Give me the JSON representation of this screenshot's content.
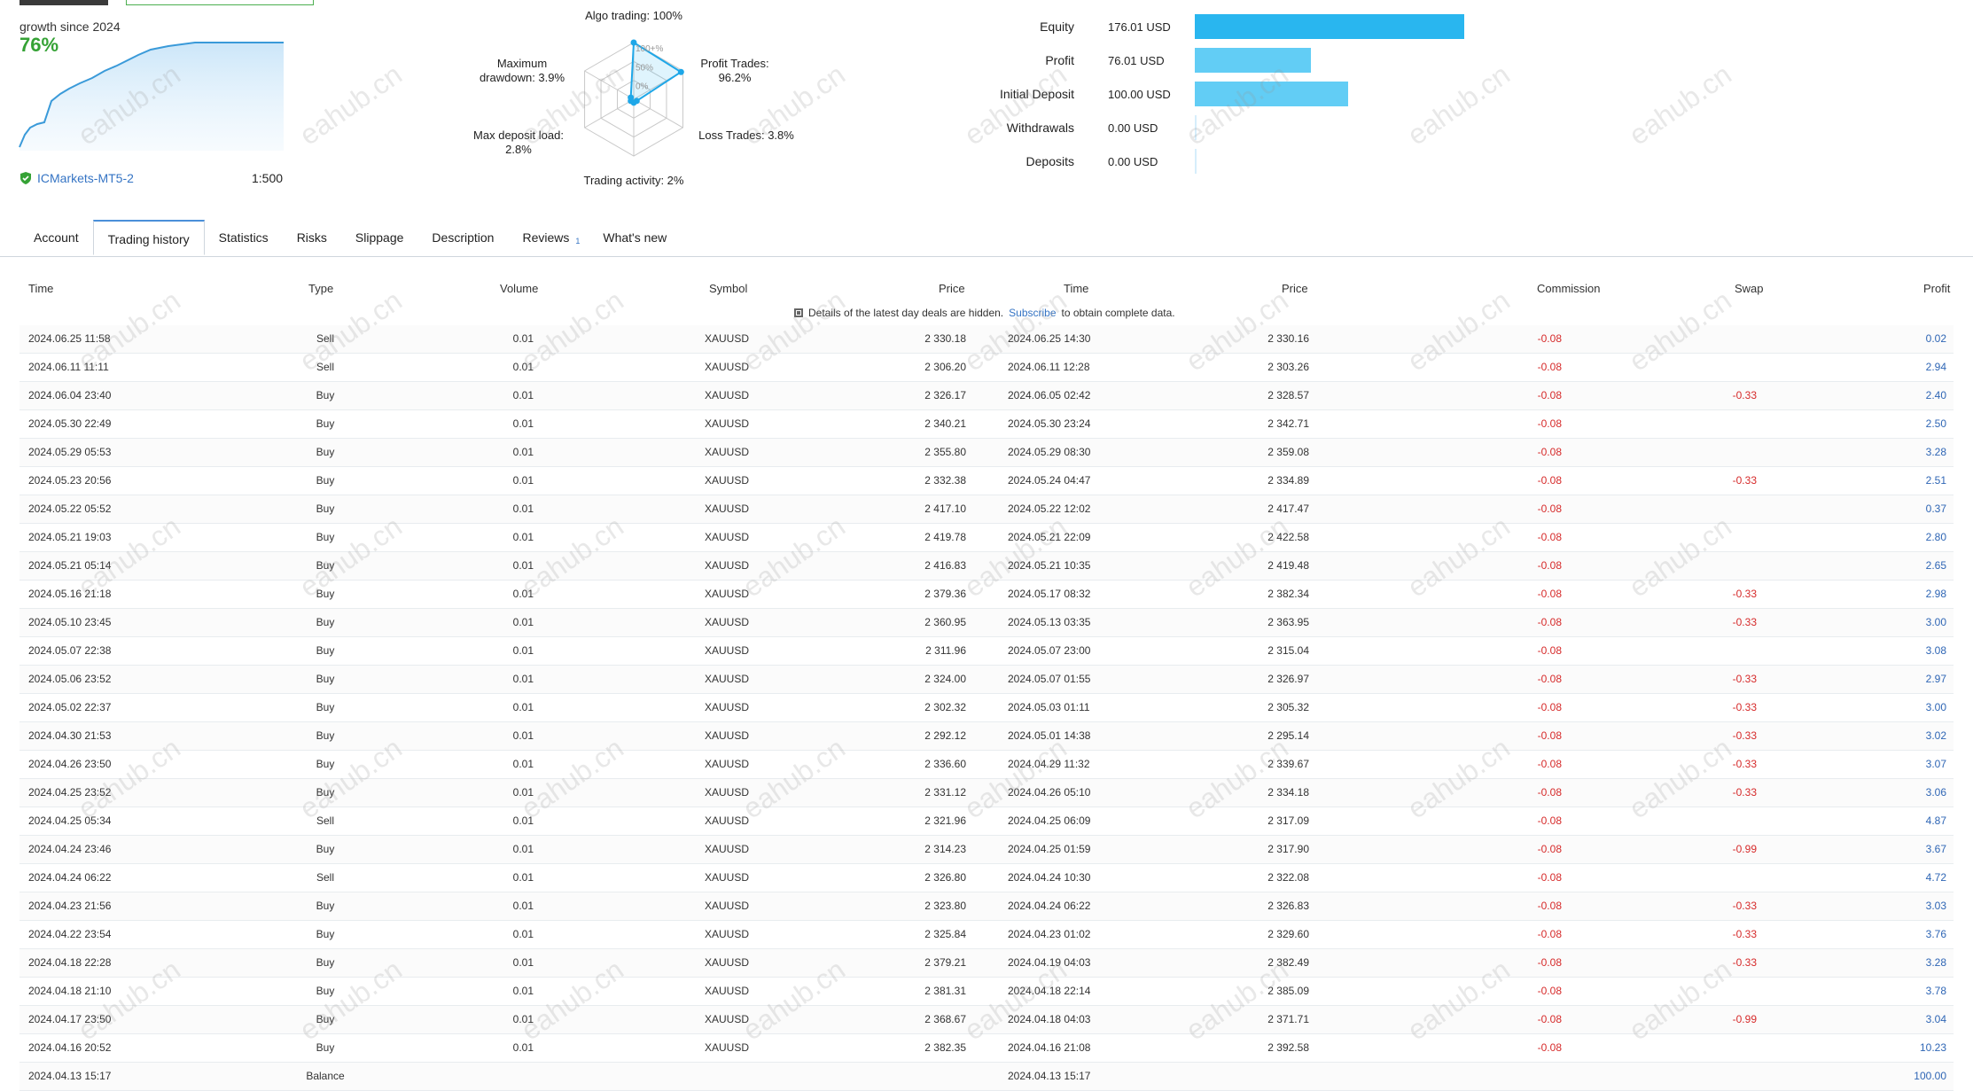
{
  "header": {
    "growth_label": "growth since 2024",
    "growth_value": "76%",
    "broker": "ICMarkets-MT5-2",
    "leverage": "1:500"
  },
  "radar": {
    "algo": "Algo trading: 100%",
    "profit": "Profit Trades:\n96.2%",
    "loss": "Loss Trades: 3.8%",
    "activity": "Trading activity: 2%",
    "deposit_load": "Max deposit load:\n2.8%",
    "drawdown": "Maximum\ndrawdown: 3.9%",
    "ring_100": "100+%",
    "ring_50": "50%",
    "ring_0": "0%",
    "algo_value": 1.0,
    "profit_value": 0.962,
    "loss_value": 0.038,
    "activity_value": 0.02,
    "deposit_load_value": 0.028,
    "drawdown_value": 0.039
  },
  "finance": [
    {
      "label": "Equity",
      "value": "176.01 USD",
      "fraction": 1.0,
      "color": "#29b6ef"
    },
    {
      "label": "Profit",
      "value": "76.01 USD",
      "fraction": 0.43,
      "color": "#62cdf5"
    },
    {
      "label": "Initial Deposit",
      "value": "100.00 USD",
      "fraction": 0.568,
      "color": "#62cdf5"
    },
    {
      "label": "Withdrawals",
      "value": "0.00 USD",
      "fraction": 0,
      "color": "#62cdf5"
    },
    {
      "label": "Deposits",
      "value": "0.00 USD",
      "fraction": 0,
      "color": "#62cdf5"
    }
  ],
  "tabs": [
    {
      "label": "Account"
    },
    {
      "label": "Trading history",
      "active": true
    },
    {
      "label": "Statistics"
    },
    {
      "label": "Risks"
    },
    {
      "label": "Slippage"
    },
    {
      "label": "Description"
    },
    {
      "label": "Reviews",
      "badge": "1"
    },
    {
      "label": "What's new"
    }
  ],
  "columns": {
    "open_time": "Time",
    "type": "Type",
    "volume": "Volume",
    "symbol": "Symbol",
    "open_price": "Price",
    "close_time": "Time",
    "close_price": "Price",
    "commission": "Commission",
    "swap": "Swap",
    "profit": "Profit"
  },
  "notice": {
    "text_before": "Details of the latest day deals are hidden.",
    "link": "Subscribe",
    "text_after": "to obtain complete data."
  },
  "watermark": "eahub.cn",
  "rows": [
    [
      "2024.06.25 11:58",
      "Sell",
      "0.01",
      "XAUUSD",
      "2 330.18",
      "2024.06.25 14:30",
      "2 330.16",
      "-0.08",
      "",
      "0.02"
    ],
    [
      "2024.06.11 11:11",
      "Sell",
      "0.01",
      "XAUUSD",
      "2 306.20",
      "2024.06.11 12:28",
      "2 303.26",
      "-0.08",
      "",
      "2.94"
    ],
    [
      "2024.06.04 23:40",
      "Buy",
      "0.01",
      "XAUUSD",
      "2 326.17",
      "2024.06.05 02:42",
      "2 328.57",
      "-0.08",
      "-0.33",
      "2.40"
    ],
    [
      "2024.05.30 22:49",
      "Buy",
      "0.01",
      "XAUUSD",
      "2 340.21",
      "2024.05.30 23:24",
      "2 342.71",
      "-0.08",
      "",
      "2.50"
    ],
    [
      "2024.05.29 05:53",
      "Buy",
      "0.01",
      "XAUUSD",
      "2 355.80",
      "2024.05.29 08:30",
      "2 359.08",
      "-0.08",
      "",
      "3.28"
    ],
    [
      "2024.05.23 20:56",
      "Buy",
      "0.01",
      "XAUUSD",
      "2 332.38",
      "2024.05.24 04:47",
      "2 334.89",
      "-0.08",
      "-0.33",
      "2.51"
    ],
    [
      "2024.05.22 05:52",
      "Buy",
      "0.01",
      "XAUUSD",
      "2 417.10",
      "2024.05.22 12:02",
      "2 417.47",
      "-0.08",
      "",
      "0.37"
    ],
    [
      "2024.05.21 19:03",
      "Buy",
      "0.01",
      "XAUUSD",
      "2 419.78",
      "2024.05.21 22:09",
      "2 422.58",
      "-0.08",
      "",
      "2.80"
    ],
    [
      "2024.05.21 05:14",
      "Buy",
      "0.01",
      "XAUUSD",
      "2 416.83",
      "2024.05.21 10:35",
      "2 419.48",
      "-0.08",
      "",
      "2.65"
    ],
    [
      "2024.05.16 21:18",
      "Buy",
      "0.01",
      "XAUUSD",
      "2 379.36",
      "2024.05.17 08:32",
      "2 382.34",
      "-0.08",
      "-0.33",
      "2.98"
    ],
    [
      "2024.05.10 23:45",
      "Buy",
      "0.01",
      "XAUUSD",
      "2 360.95",
      "2024.05.13 03:35",
      "2 363.95",
      "-0.08",
      "-0.33",
      "3.00"
    ],
    [
      "2024.05.07 22:38",
      "Buy",
      "0.01",
      "XAUUSD",
      "2 311.96",
      "2024.05.07 23:00",
      "2 315.04",
      "-0.08",
      "",
      "3.08"
    ],
    [
      "2024.05.06 23:52",
      "Buy",
      "0.01",
      "XAUUSD",
      "2 324.00",
      "2024.05.07 01:55",
      "2 326.97",
      "-0.08",
      "-0.33",
      "2.97"
    ],
    [
      "2024.05.02 22:37",
      "Buy",
      "0.01",
      "XAUUSD",
      "2 302.32",
      "2024.05.03 01:11",
      "2 305.32",
      "-0.08",
      "-0.33",
      "3.00"
    ],
    [
      "2024.04.30 21:53",
      "Buy",
      "0.01",
      "XAUUSD",
      "2 292.12",
      "2024.05.01 14:38",
      "2 295.14",
      "-0.08",
      "-0.33",
      "3.02"
    ],
    [
      "2024.04.26 23:50",
      "Buy",
      "0.01",
      "XAUUSD",
      "2 336.60",
      "2024.04.29 11:32",
      "2 339.67",
      "-0.08",
      "-0.33",
      "3.07"
    ],
    [
      "2024.04.25 23:52",
      "Buy",
      "0.01",
      "XAUUSD",
      "2 331.12",
      "2024.04.26 05:10",
      "2 334.18",
      "-0.08",
      "-0.33",
      "3.06"
    ],
    [
      "2024.04.25 05:34",
      "Sell",
      "0.01",
      "XAUUSD",
      "2 321.96",
      "2024.04.25 06:09",
      "2 317.09",
      "-0.08",
      "",
      "4.87"
    ],
    [
      "2024.04.24 23:46",
      "Buy",
      "0.01",
      "XAUUSD",
      "2 314.23",
      "2024.04.25 01:59",
      "2 317.90",
      "-0.08",
      "-0.99",
      "3.67"
    ],
    [
      "2024.04.24 06:22",
      "Sell",
      "0.01",
      "XAUUSD",
      "2 326.80",
      "2024.04.24 10:30",
      "2 322.08",
      "-0.08",
      "",
      "4.72"
    ],
    [
      "2024.04.23 21:56",
      "Buy",
      "0.01",
      "XAUUSD",
      "2 323.80",
      "2024.04.24 06:22",
      "2 326.83",
      "-0.08",
      "-0.33",
      "3.03"
    ],
    [
      "2024.04.22 23:54",
      "Buy",
      "0.01",
      "XAUUSD",
      "2 325.84",
      "2024.04.23 01:02",
      "2 329.60",
      "-0.08",
      "-0.33",
      "3.76"
    ],
    [
      "2024.04.18 22:28",
      "Buy",
      "0.01",
      "XAUUSD",
      "2 379.21",
      "2024.04.19 04:03",
      "2 382.49",
      "-0.08",
      "-0.33",
      "3.28"
    ],
    [
      "2024.04.18 21:10",
      "Buy",
      "0.01",
      "XAUUSD",
      "2 381.31",
      "2024.04.18 22:14",
      "2 385.09",
      "-0.08",
      "",
      "3.78"
    ],
    [
      "2024.04.17 23:50",
      "Buy",
      "0.01",
      "XAUUSD",
      "2 368.67",
      "2024.04.18 04:03",
      "2 371.71",
      "-0.08",
      "-0.99",
      "3.04"
    ],
    [
      "2024.04.16 20:52",
      "Buy",
      "0.01",
      "XAUUSD",
      "2 382.35",
      "2024.04.16 21:08",
      "2 392.58",
      "-0.08",
      "",
      "10.23"
    ],
    [
      "2024.04.13 15:17",
      "Balance",
      "",
      "",
      "",
      "2024.04.13 15:17",
      "",
      "",
      "",
      "100.00"
    ]
  ]
}
